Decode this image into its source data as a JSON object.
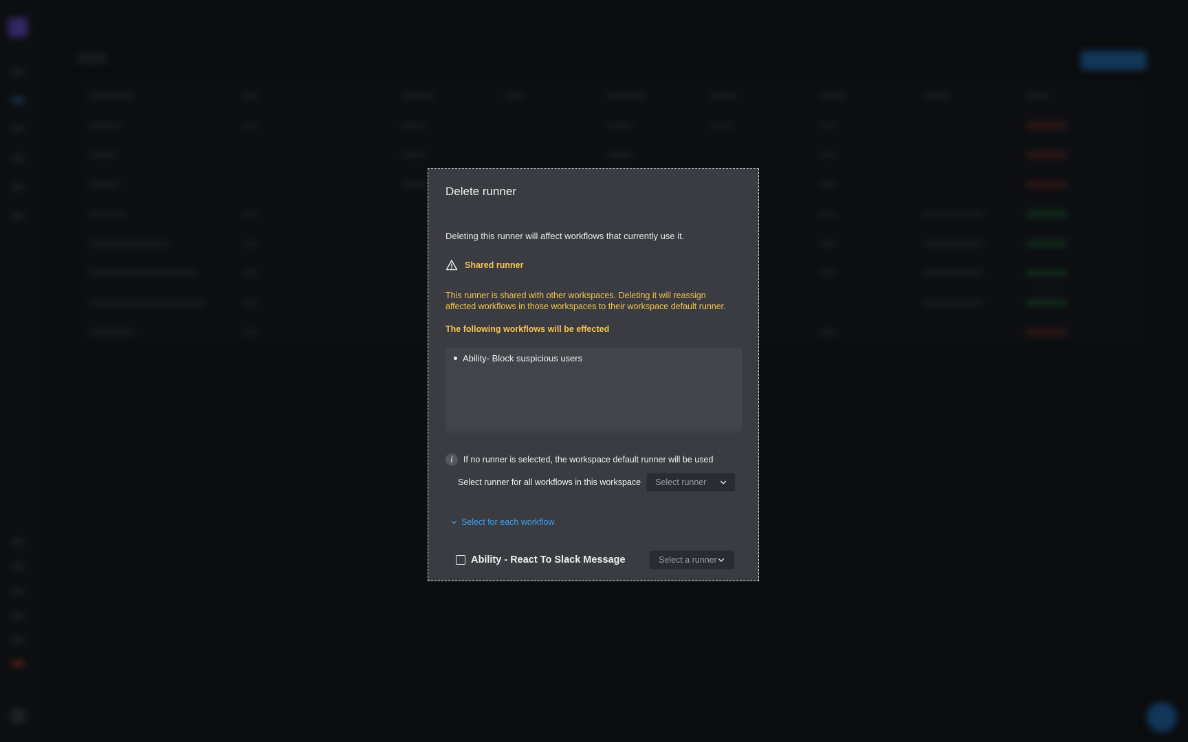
{
  "modal": {
    "title": "Delete runner",
    "description": "Deleting this runner will affect workflows that currently use it.",
    "warning_label": "Shared runner",
    "warning_text": "This runner is shared with other workspaces. Deleting it will reassign affected workflows in those workspaces to their workspace default runner.",
    "effected_heading": "The following workflows will be effected",
    "affected_workflows": [
      "Ability- Block suspicious users"
    ],
    "info_text": "If no runner is selected, the workspace default runner will be used",
    "select_all_label": "Select runner for all workflows in this workspace",
    "select_all_placeholder": "Select runner",
    "toggle_label": "Select for each workflow",
    "workflow_rows": [
      {
        "name": "Ability - React To Slack Message",
        "placeholder": "Select a runner",
        "checked": false
      }
    ]
  },
  "colors": {
    "warning": "#f5c451",
    "link": "#3aa0f0",
    "modal_bg": "#3a3c41"
  },
  "icons": {
    "warning": "warning-triangle-icon",
    "info": "info-icon",
    "chevron": "chevron-down-icon"
  }
}
